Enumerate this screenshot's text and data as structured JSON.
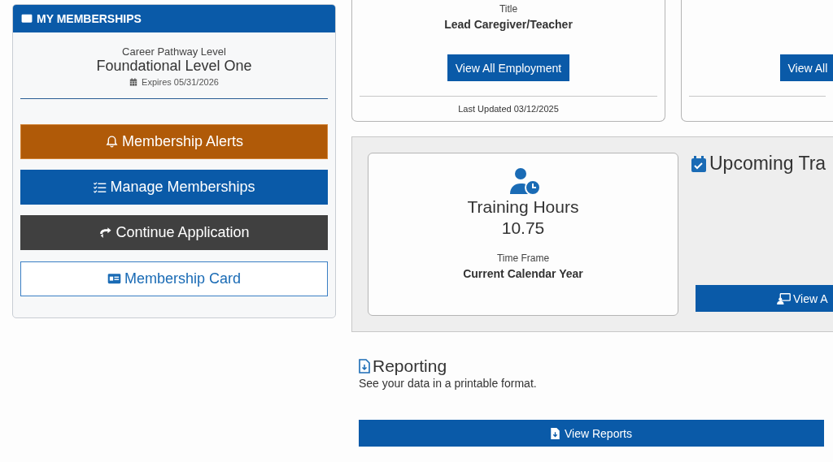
{
  "memberships": {
    "title": "MY MEMBERSHIPS",
    "level_label": "Career Pathway Level",
    "level": "Foundational Level One",
    "expires": "Expires 05/31/2026",
    "buttons": [
      {
        "kind": "alerts",
        "label": "Membership Alerts"
      },
      {
        "kind": "manage",
        "label": "Manage Memberships"
      },
      {
        "kind": "continue",
        "label": "Continue Application"
      },
      {
        "kind": "card",
        "label": "Membership Card"
      }
    ]
  },
  "employment_cards": [
    {
      "field_label": "Title",
      "field_value": "Lead Caregiver/Teacher",
      "button": "View All Employment",
      "updated": "Last Updated 03/12/2025"
    },
    {
      "button": "View All"
    }
  ],
  "training": {
    "hours_label": "Training Hours",
    "hours": "10.75",
    "time_frame_label": "Time Frame",
    "time_frame": "Current Calendar Year",
    "upcoming_title": "Upcoming Tra",
    "upcoming_button": "View A"
  },
  "reporting": {
    "title": "Reporting",
    "description": "See your data in a printable format.",
    "button": "View Reports"
  }
}
